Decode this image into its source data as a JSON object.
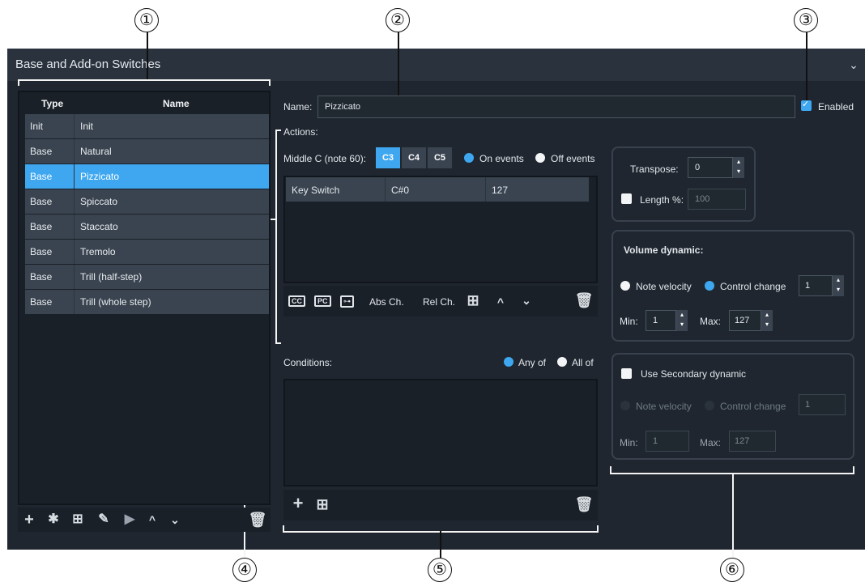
{
  "panel": {
    "title": "Base and Add-on Switches"
  },
  "callouts": [
    "①",
    "②",
    "③",
    "④",
    "⑤",
    "⑥"
  ],
  "list": {
    "headers": {
      "type": "Type",
      "name": "Name"
    },
    "rows": [
      {
        "type": "Init",
        "name": "Init"
      },
      {
        "type": "Base",
        "name": "Natural"
      },
      {
        "type": "Base",
        "name": "Pizzicato"
      },
      {
        "type": "Base",
        "name": "Spiccato"
      },
      {
        "type": "Base",
        "name": "Staccato"
      },
      {
        "type": "Base",
        "name": "Tremolo"
      },
      {
        "type": "Base",
        "name": "Trill (half-step)"
      },
      {
        "type": "Base",
        "name": "Trill (whole step)"
      }
    ],
    "selected_index": 2
  },
  "name_field": {
    "label": "Name:",
    "value": "Pizzicato"
  },
  "enabled": {
    "label": "Enabled",
    "checked": true
  },
  "actions": {
    "label": "Actions:",
    "middle_c_label": "Middle C (note 60):",
    "octaves": [
      "C3",
      "C4",
      "C5"
    ],
    "selected_octave": "C3",
    "on_events": "On events",
    "off_events": "Off events",
    "table_row": {
      "type": "Key Switch",
      "note": "C#0",
      "value": "127"
    },
    "toolbar": {
      "cc": "CC",
      "pc": "PC",
      "abs": "Abs Ch.",
      "rel": "Rel Ch."
    }
  },
  "transpose": {
    "label": "Transpose:",
    "value": "0",
    "length_label": "Length %:",
    "length_value": "100"
  },
  "volume": {
    "label": "Volume dynamic:",
    "note_velocity": "Note velocity",
    "control_change": "Control change",
    "cc_value": "1",
    "min_label": "Min:",
    "min_value": "1",
    "max_label": "Max:",
    "max_value": "127"
  },
  "conditions": {
    "label": "Conditions:",
    "any_of": "Any of",
    "all_of": "All of"
  },
  "secondary": {
    "label": "Use Secondary dynamic",
    "note_velocity": "Note velocity",
    "control_change": "Control change",
    "cc_value": "1",
    "min_label": "Min:",
    "min_value": "1",
    "max_label": "Max:",
    "max_value": "127"
  },
  "colors": {
    "accent": "#3ea7f0",
    "panel": "#1f262f",
    "row": "#3a4450"
  }
}
